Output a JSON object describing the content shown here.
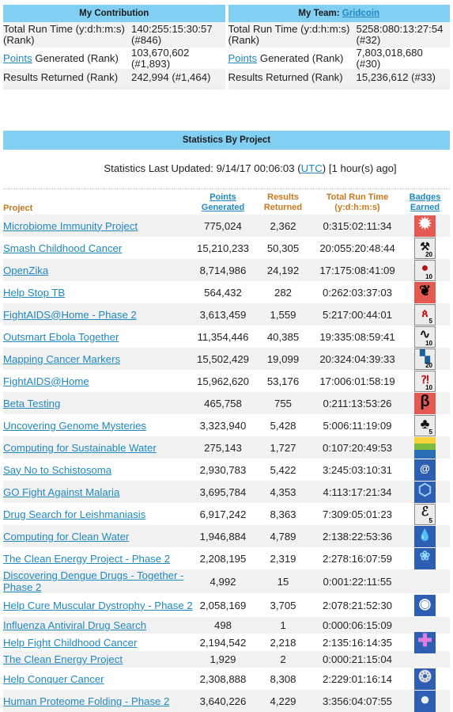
{
  "my_contribution": {
    "title": "My Contribution",
    "rows": [
      {
        "label": "Total Run Time (y:d:h:m:s) (Rank)",
        "value": "140:255:15:30:57 (#846)"
      },
      {
        "label_link": "Points",
        "label_rest": " Generated (Rank)",
        "value": "103,670,602 (#1,893)"
      },
      {
        "label": "Results Returned (Rank)",
        "value": "242,994 (#1,464)"
      }
    ]
  },
  "my_team": {
    "title_prefix": "My Team: ",
    "team_link": "Gridcoin",
    "rows": [
      {
        "label": "Total Run Time (y:d:h:m:s) (Rank)",
        "value": "5258:080:13:27:54 (#32)"
      },
      {
        "label_link": "Points",
        "label_rest": " Generated (Rank)",
        "value": "7,803,018,680 (#30)"
      },
      {
        "label": "Results Returned (Rank)",
        "value": "15,236,612 (#33)"
      }
    ]
  },
  "stats": {
    "title": "Statistics By Project",
    "updated_prefix": "Statistics Last Updated: 9/14/17 00:06:03 (",
    "updated_link": "UTC",
    "updated_suffix": ") [1 hour(s) ago]",
    "columns": {
      "project": "Project",
      "points": "Points Generated",
      "results": "Results Returned",
      "runtime": "Total Run Time (y:d:h:m:s)",
      "badges": "Badges Earned"
    },
    "rows": [
      {
        "project": "Microbiome Immunity Project",
        "points": "775,024",
        "results": "2,362",
        "runtime": "0:315:02:11:34",
        "badge": "sun-virus",
        "badge_num": ""
      },
      {
        "project": "Smash Childhood Cancer",
        "points": "15,210,233",
        "results": "50,305",
        "runtime": "20:055:20:48:44",
        "badge": "hammer",
        "badge_num": "20"
      },
      {
        "project": "OpenZika",
        "points": "8,714,986",
        "results": "24,192",
        "runtime": "17:175:08:41:09",
        "badge": "zika",
        "badge_num": "10"
      },
      {
        "project": "Help Stop TB",
        "points": "564,432",
        "results": "282",
        "runtime": "0:262:03:37:03",
        "badge": "lungs",
        "badge_num": ""
      },
      {
        "project": "FightAIDS@Home - Phase 2",
        "points": "3,613,459",
        "results": "1,559",
        "runtime": "5:217:00:44:01",
        "badge": "ribbons",
        "badge_num": "5"
      },
      {
        "project": "Outsmart Ebola Together",
        "points": "11,354,446",
        "results": "40,385",
        "runtime": "19:335:08:59:41",
        "badge": "ebola",
        "badge_num": "10"
      },
      {
        "project": "Mapping Cancer Markers",
        "points": "15,502,429",
        "results": "19,099",
        "runtime": "20:324:04:39:33",
        "badge": "markers",
        "badge_num": "20"
      },
      {
        "project": "FightAIDS@Home",
        "points": "15,962,620",
        "results": "53,176",
        "runtime": "17:006:01:58:19",
        "badge": "ribbon",
        "badge_num": "10"
      },
      {
        "project": "Beta Testing",
        "points": "465,758",
        "results": "755",
        "runtime": "0:211:13:53:26",
        "badge": "beta",
        "badge_num": ""
      },
      {
        "project": "Uncovering Genome Mysteries",
        "points": "3,323,940",
        "results": "5,428",
        "runtime": "5:006:11:19:09",
        "badge": "tree",
        "badge_num": "5"
      },
      {
        "project": "Computing for Sustainable Water",
        "points": "275,143",
        "results": "1,727",
        "runtime": "0:107:20:49:53",
        "badge": "water",
        "badge_num": ""
      },
      {
        "project": "Say No to Schistosoma",
        "points": "2,930,783",
        "results": "5,422",
        "runtime": "3:245:03:10:31",
        "badge": "snail",
        "badge_num": ""
      },
      {
        "project": "GO Fight Against Malaria",
        "points": "3,695,784",
        "results": "4,353",
        "runtime": "4:113:17:21:34",
        "badge": "mosquito",
        "badge_num": ""
      },
      {
        "project": "Drug Search for Leishmaniasis",
        "points": "6,917,242",
        "results": "8,363",
        "runtime": "7:309:05:01:23",
        "badge": "sandfly",
        "badge_num": "5"
      },
      {
        "project": "Computing for Clean Water",
        "points": "1,946,884",
        "results": "4,789",
        "runtime": "2:138:22:53:36",
        "badge": "drop",
        "badge_num": ""
      },
      {
        "project": "The Clean Energy Project - Phase 2",
        "points": "2,208,195",
        "results": "2,319",
        "runtime": "2:278:16:07:59",
        "badge": "butterfly",
        "badge_num": ""
      },
      {
        "project": "Discovering Dengue Drugs - Together - Phase 2",
        "points": "4,992",
        "results": "15",
        "runtime": "0:001:22:11:55",
        "badge": "",
        "badge_num": ""
      },
      {
        "project": "Help Cure Muscular Dystrophy - Phase 2",
        "points": "2,058,169",
        "results": "3,705",
        "runtime": "2:078:21:52:30",
        "badge": "muscular",
        "badge_num": ""
      },
      {
        "project": "Influenza Antiviral Drug Search",
        "points": "498",
        "results": "1",
        "runtime": "0:000:06:15:09",
        "badge": "",
        "badge_num": ""
      },
      {
        "project": "Help Fight Childhood Cancer",
        "points": "2,194,542",
        "results": "2,218",
        "runtime": "2:135:16:14:35",
        "badge": "person",
        "badge_num": ""
      },
      {
        "project": "The Clean Energy Project",
        "points": "1,929",
        "results": "2",
        "runtime": "0:000:21:15:04",
        "badge": "",
        "badge_num": ""
      },
      {
        "project": "Help Conquer Cancer",
        "points": "2,308,888",
        "results": "8,308",
        "runtime": "2:229:01:16:14",
        "badge": "cells",
        "badge_num": ""
      },
      {
        "project": "Human Proteome Folding - Phase 2",
        "points": "3,640,226",
        "results": "4,229",
        "runtime": "3:356:04:07:55",
        "badge": "proteome",
        "badge_num": ""
      }
    ]
  }
}
